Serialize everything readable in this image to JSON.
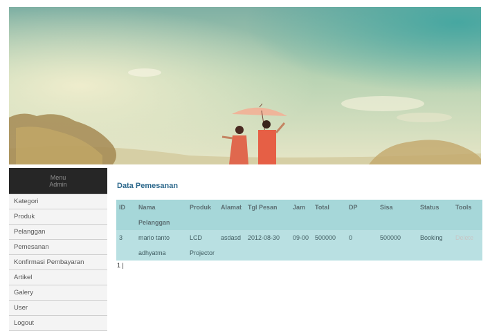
{
  "sidebar": {
    "header_line1": "Menu",
    "header_line2": "Admin",
    "items": [
      "Kategori",
      "Produk",
      "Pelanggan",
      "Pemesanan",
      "Konfirmasi Pembayaran",
      "Artikel",
      "Galery",
      "User",
      "Logout"
    ]
  },
  "main": {
    "title": "Data Pemesanan",
    "table": {
      "headers": [
        "ID",
        "Nama Pelanggan",
        "Produk",
        "Alamat",
        "Tgl Pesan",
        "Jam",
        "Total",
        "DP",
        "Sisa",
        "Status",
        "Tools"
      ],
      "rows": [
        [
          "3",
          "mario tanto adhyatma",
          "LCD Projector",
          "asdasd",
          "2012-08-30",
          "09-00",
          "500000",
          "0",
          "500000",
          "Booking",
          "Delete"
        ]
      ]
    },
    "pager": "1 |"
  },
  "colors": {
    "header_bg": "#262626",
    "table_header": "#a6d7d9",
    "table_row": "#b9e0e2",
    "title": "#2f6a8d"
  }
}
